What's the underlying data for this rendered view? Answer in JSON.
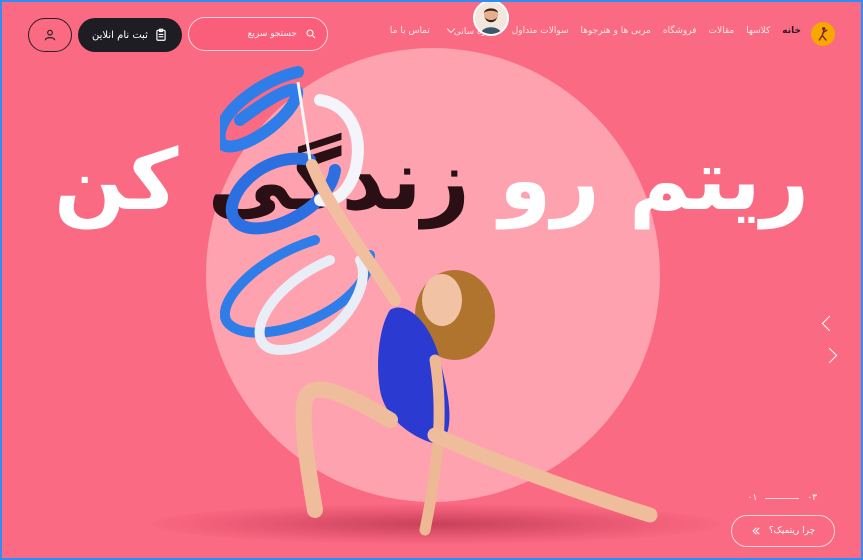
{
  "header": {
    "register_label": "ثبت نام انلاین",
    "search_placeholder": "جستجو سریع",
    "nav": [
      {
        "label": "خانه",
        "active": true
      },
      {
        "label": "کلاسها"
      },
      {
        "label": "مقالات"
      },
      {
        "label": "فروشگاه"
      },
      {
        "label": "مربی ها و هنرجوها"
      },
      {
        "label": "سوالات متداول"
      },
      {
        "label": "درباره سانی",
        "dropdown": true
      },
      {
        "label": "تماس با ما"
      }
    ]
  },
  "hero": {
    "title_white_1": "ریتم رو",
    "title_dark": "زندگی",
    "title_white_2": "کن"
  },
  "slider": {
    "current": "۰۱",
    "total": "۰۳"
  },
  "cta": {
    "why_label": "چرا ریتمیک؟"
  },
  "colors": {
    "background": "#fb6a83",
    "circle": "#ffa2b0",
    "button_dark": "#1f1d24",
    "logo": "#f6a700"
  }
}
